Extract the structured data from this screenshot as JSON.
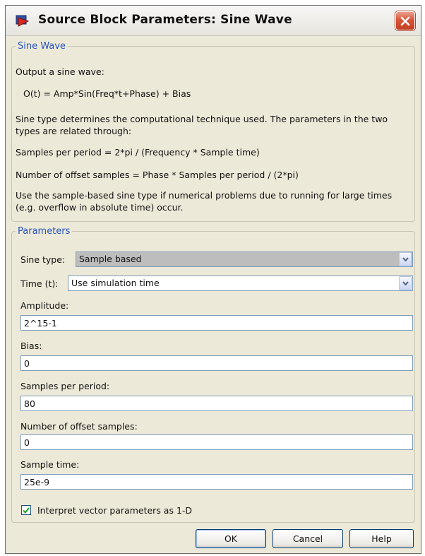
{
  "window": {
    "title": "Source Block Parameters: Sine Wave",
    "close_icon": "close-x-icon"
  },
  "description_group": {
    "legend": "Sine Wave",
    "lines": [
      "Output a sine wave:",
      "O(t) = Amp*Sin(Freq*t+Phase) + Bias",
      "Sine type determines the computational technique used. The parameters in the two",
      "types are related through:",
      "Samples per period = 2*pi / (Frequency * Sample time)",
      "Number of offset samples = Phase * Samples per period / (2*pi)",
      "Use the sample-based sine type if numerical problems due to running for large times",
      "(e.g. overflow in absolute time) occur."
    ]
  },
  "parameters": {
    "legend": "Parameters",
    "sine_type": {
      "label": "Sine type:",
      "value": "Sample based"
    },
    "time": {
      "label": "Time (t):",
      "value": "Use simulation time"
    },
    "fields": [
      {
        "label": "Amplitude:",
        "value": "2^15-1"
      },
      {
        "label": "Bias:",
        "value": "0"
      },
      {
        "label": "Samples per period:",
        "value": "80"
      },
      {
        "label": "Number of offset samples:",
        "value": "0"
      },
      {
        "label": "Sample time:",
        "value": "25e-9"
      }
    ],
    "vector_checkbox": {
      "label": "Interpret vector parameters as 1-D",
      "checked": true
    }
  },
  "buttons": {
    "ok": "OK",
    "cancel": "Cancel",
    "help": "Help"
  },
  "colors": {
    "legend": "#2553c2",
    "dialog_bg": "#ece9d8",
    "selected_combo_bg": "#bdbdbd",
    "close_button": "#d9553a"
  }
}
